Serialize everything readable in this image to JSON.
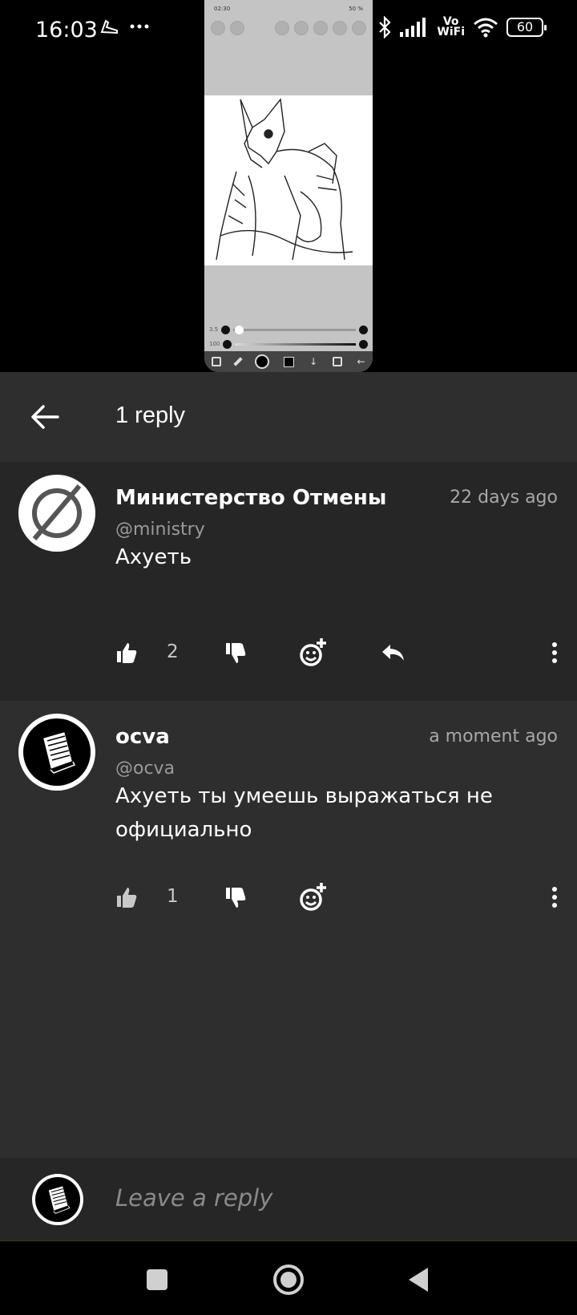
{
  "status_bar": {
    "time": "16:03",
    "battery": "60",
    "vowifi_top": "Vo",
    "vowifi_bottom": "WiFi"
  },
  "media_preview": {
    "inner_time": "02:30",
    "inner_battery": "50 %",
    "slider_size": "3.5",
    "slider_opacity": "100"
  },
  "header": {
    "title": "1 reply",
    "back_icon": "arrow-left-icon"
  },
  "comments": [
    {
      "author": "Министерство Отмены",
      "handle": "@ministry",
      "time": "22 days ago",
      "text": "Ахуеть",
      "likes": "2",
      "avatar_icon": "empty-set-icon",
      "show_reply": true
    },
    {
      "author": "ocva",
      "handle": "@ocva",
      "time": "a moment ago",
      "text": "Ахуеть ты умеешь выражаться не официально",
      "likes": "1",
      "avatar_icon": "book-icon",
      "show_reply": false
    }
  ],
  "reply_bar": {
    "placeholder": "Leave a reply"
  },
  "colors": {
    "background": "#2e2e2e",
    "alt_background": "#262626",
    "text": "#ffffff",
    "muted": "#9a9a9a"
  }
}
